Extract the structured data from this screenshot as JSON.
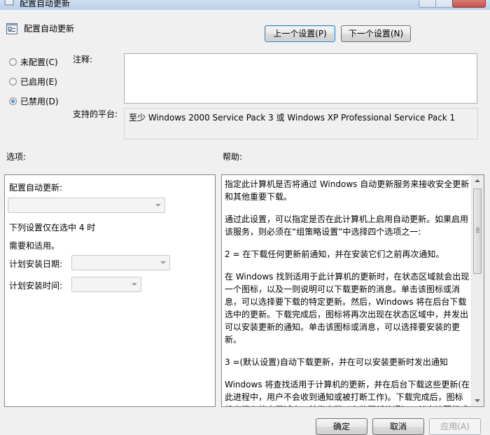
{
  "window": {
    "title": "配置自动更新"
  },
  "header": {
    "title": "配置自动更新",
    "prev_button": "上一个设置(P)",
    "next_button": "下一个设置(N)"
  },
  "state": {
    "options": [
      {
        "label": "未配置(C)",
        "checked": false
      },
      {
        "label": "已启用(E)",
        "checked": false
      },
      {
        "label": "已禁用(D)",
        "checked": true
      }
    ]
  },
  "comment": {
    "label": "注释:",
    "value": ""
  },
  "platform": {
    "label": "支持的平台:",
    "value": "至少 Windows 2000 Service Pack 3 或 Windows XP Professional Service Pack 1"
  },
  "options_section": {
    "heading": "选项:",
    "configure_label": "配置自动更新:",
    "configure_value": "",
    "note_line1": "下列设置仅在选中 4 时",
    "note_line2": "需要和适用。",
    "schedule_day_label": "计划安装日期:",
    "schedule_day_value": "",
    "schedule_time_label": "计划安装时间:",
    "schedule_time_value": ""
  },
  "help_section": {
    "heading": "帮助:",
    "paragraphs": [
      "指定此计算机是否将通过 Windows 自动更新服务来接收安全更新和其他重要下载。",
      "通过此设置，可以指定是否在此计算机上启用自动更新。如果启用该服务，则必须在“组策略设置”中选择四个选项之一:",
      "2 = 在下载任何更新前通知，并在安装它们之前再次通知。",
      "在 Windows 找到适用于此计算机的更新时，在状态区域就会出现一个图标，以及一则说明可以下载更新的消息。单击该图标或消息，可以选择要下载的特定更新。然后，Windows 将在后台下载选中的更新。下载完成后，图标将再次出现在状态区域中，并发出可以安装更新的通知。单击该图标或消息，可以选择要安装的更新。",
      "3 =(默认设置)自动下载更新，并在可以安装更新时发出通知",
      "Windows 将查找适用于计算机的更新，并在后台下载这些更新(在此进程中，用户不会收到通知或被打断工作)。下载完成后，图标将出现在状态区域中，并发出可以安装更新的通知。单击该图标或"
    ]
  },
  "footer": {
    "ok_button": "确定",
    "cancel_button": "取消",
    "apply_button": "应用(A)"
  },
  "colors": {
    "dialog_bg": "#f0f0f0",
    "focus_border": "#3c7fb1",
    "radio_fill": "#1c5a9e"
  }
}
